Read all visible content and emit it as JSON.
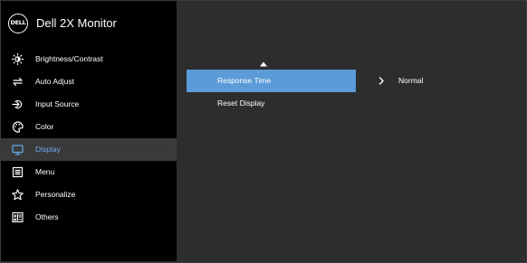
{
  "header": {
    "logo_text": "DELL",
    "title": "Dell 2X Monitor"
  },
  "sidebar": {
    "items": [
      {
        "label": "Brightness/Contrast",
        "icon": "brightness-icon"
      },
      {
        "label": "Auto Adjust",
        "icon": "auto-adjust-icon"
      },
      {
        "label": "Input Source",
        "icon": "input-source-icon"
      },
      {
        "label": "Color",
        "icon": "color-icon"
      },
      {
        "label": "Display",
        "icon": "display-icon",
        "active": true
      },
      {
        "label": "Menu",
        "icon": "menu-icon"
      },
      {
        "label": "Personalize",
        "icon": "star-icon"
      },
      {
        "label": "Others",
        "icon": "others-icon"
      }
    ]
  },
  "panel": {
    "options": [
      {
        "label": "Response Time",
        "selected": true
      },
      {
        "label": "Reset Display",
        "selected": false
      }
    ],
    "selected_value": "Normal"
  },
  "colors": {
    "accent": "#5b9bd8",
    "active_text": "#6aa9ea",
    "sidebar_bg": "#000000",
    "panel_bg": "#2d2d2d"
  }
}
